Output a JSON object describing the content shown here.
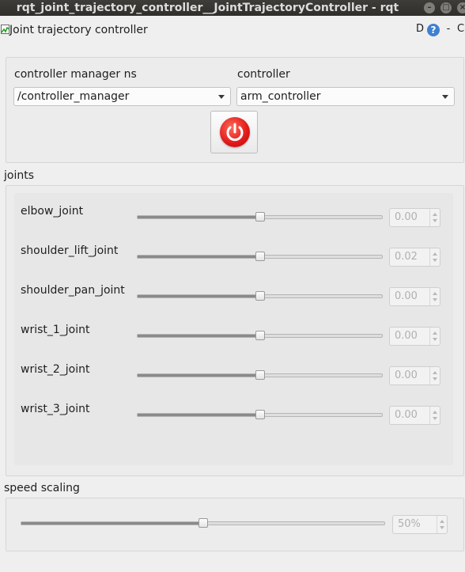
{
  "window": {
    "title": "rqt_joint_trajectory_controller__JointTrajectoryController - rqt"
  },
  "plugin": {
    "title": "Joint trajectory controller",
    "d_label": "D",
    "help_label": "?",
    "o_label": "-",
    "c_label": "C"
  },
  "controller_select": {
    "manager_label": "controller manager ns",
    "manager_value": "/controller_manager",
    "controller_label": "controller",
    "controller_value": "arm_controller",
    "power_icon": "power-icon",
    "power_color": "#e02020"
  },
  "joints": {
    "section_label": "joints",
    "items": [
      {
        "name": "elbow_joint",
        "value": "0.00",
        "position_fraction": 0.5
      },
      {
        "name": "shoulder_lift_joint",
        "value": "0.02",
        "position_fraction": 0.5
      },
      {
        "name": "shoulder_pan_joint",
        "value": "0.00",
        "position_fraction": 0.5
      },
      {
        "name": "wrist_1_joint",
        "value": "0.00",
        "position_fraction": 0.5
      },
      {
        "name": "wrist_2_joint",
        "value": "0.00",
        "position_fraction": 0.5
      },
      {
        "name": "wrist_3_joint",
        "value": "0.00",
        "position_fraction": 0.5
      }
    ]
  },
  "speed_scaling": {
    "label": "speed scaling",
    "value": "50%",
    "fraction": 0.5
  }
}
